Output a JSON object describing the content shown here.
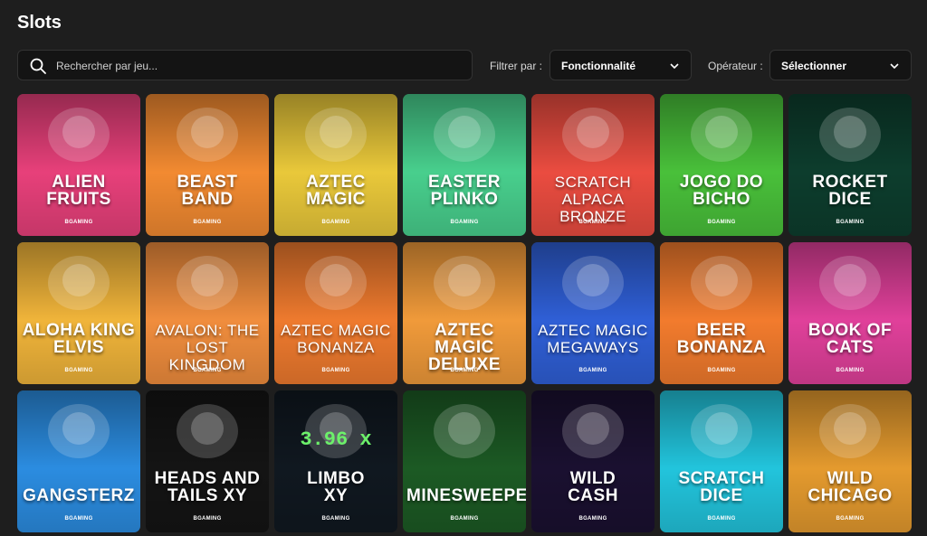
{
  "page": {
    "title": "Slots"
  },
  "search": {
    "placeholder": "Rechercher par jeu..."
  },
  "filters": {
    "filter_label": "Filtrer par :",
    "filter_value": "Fonctionnalité",
    "operator_label": "Opérateur :",
    "operator_value": "Sélectionner"
  },
  "games": [
    {
      "name": "ALIEN\nFRUITS",
      "provider": "BGAMING",
      "bg": "#e7407a",
      "icon": "alien-fruits-art"
    },
    {
      "name": "BEAST\nBAND",
      "provider": "BGAMING",
      "bg": "#f28a31",
      "icon": "lion-singer-art"
    },
    {
      "name": "AZTEC\nMAGIC",
      "provider": "BGAMING",
      "bg": "#e9c83a",
      "icon": "aztec-queen-art"
    },
    {
      "name": "EASTER\nPLINKO",
      "provider": "BGAMING",
      "bg": "#48cf8d",
      "icon": "green-egg-art"
    },
    {
      "name": "SCRATCH ALPACA\nBRONZE",
      "provider": "BGAMING",
      "bg": "#ea4c40",
      "icon": "alpaca-art"
    },
    {
      "name": "JOGO DO\nBICHO",
      "provider": "BGAMING",
      "bg": "#49c03a",
      "icon": "crocodile-crate-art"
    },
    {
      "name": "ROCKET\nDICE",
      "provider": "BGAMING",
      "bg": "#0d3d2d",
      "icon": "dice-cup-art"
    },
    {
      "name": "ALOHA KING\nELVIS",
      "provider": "BGAMING",
      "bg": "#f0b43a",
      "icon": "frog-king-art"
    },
    {
      "name": "AVALON: THE LOST\nKINGDOM",
      "provider": "BGAMING",
      "bg": "#f08d3d",
      "icon": "avalon-heroes-art"
    },
    {
      "name": "AZTEC MAGIC\nBONANZA",
      "provider": "BGAMING",
      "bg": "#ee7a2e",
      "icon": "aztec-warrior-art"
    },
    {
      "name": "AZTEC MAGIC\nDELUXE",
      "provider": "BGAMING",
      "bg": "#f09a3a",
      "icon": "aztec-deluxe-art"
    },
    {
      "name": "AZTEC MAGIC\nMEGAWAYS",
      "provider": "BGAMING",
      "bg": "#2f5fd6",
      "icon": "aztec-pyramid-art"
    },
    {
      "name": "BEER\nBONANZA",
      "provider": "BGAMING",
      "bg": "#f27b2d",
      "icon": "beer-barrel-art"
    },
    {
      "name": "BOOK OF\nCATS",
      "provider": "BGAMING",
      "bg": "#e0409a",
      "icon": "cat-mask-art"
    },
    {
      "name": "GANGSTERZ",
      "provider": "BGAMING",
      "bg": "#2b8ce0",
      "icon": "monsters-art"
    },
    {
      "name": "HEADS AND\nTAILS XY",
      "provider": "BGAMING",
      "bg": "#141414",
      "icon": "gold-coins-art"
    },
    {
      "name": "LIMBO\nXY",
      "provider": "BGAMING",
      "bg": "#101820",
      "icon": "limbo-screen-art",
      "extra": "3.96 x"
    },
    {
      "name": "MINESWEEPER",
      "provider": "BGAMING",
      "bg": "#1c5a24",
      "icon": "mine-flag-art"
    },
    {
      "name": "WILD\nCASH",
      "provider": "BGAMING",
      "bg": "#1a1030",
      "icon": "vortex-art"
    },
    {
      "name": "SCRATCH\nDICE",
      "provider": "BGAMING",
      "bg": "#22c4dc",
      "icon": "scratch-dice-art"
    },
    {
      "name": "WILD\nCHICAGO",
      "provider": "BGAMING",
      "bg": "#e49a2e",
      "icon": "gangster-croc-art"
    }
  ]
}
